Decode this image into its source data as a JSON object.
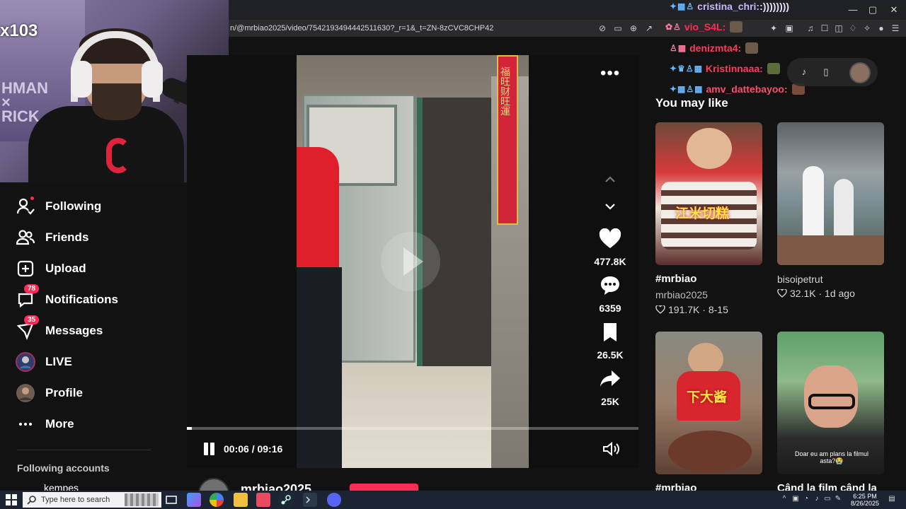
{
  "browser": {
    "url": "n/@mrbiao2025/video/7542193494442511630?_r=1&_t=ZN-8zCVC8CHP42"
  },
  "webcam": {
    "channel_id": "x103",
    "poster_text_1": "HMAN",
    "poster_text_2": "×",
    "poster_text_3": "RICK"
  },
  "sidebar": {
    "items": [
      {
        "label": "Following",
        "icon": "following-icon"
      },
      {
        "label": "Friends",
        "icon": "friends-icon"
      },
      {
        "label": "Upload",
        "icon": "upload-icon"
      },
      {
        "label": "Notifications",
        "icon": "notifications-icon",
        "badge": "78"
      },
      {
        "label": "Messages",
        "icon": "messages-icon",
        "badge": "35"
      },
      {
        "label": "LIVE",
        "icon": "live-icon"
      },
      {
        "label": "Profile",
        "icon": "profile-icon"
      },
      {
        "label": "More",
        "icon": "more-icon"
      }
    ],
    "following_header": "Following accounts",
    "following_first": "kempes"
  },
  "video": {
    "current_time": "00:06",
    "duration": "09:16",
    "time_display": "00:06 / 09:16",
    "progress": 0.011,
    "banner_text": "福旺财旺運",
    "likes": "477.8K",
    "comments": "6359",
    "saves": "26.5K",
    "shares": "25K",
    "author": "mrbiao2025"
  },
  "right_panel": {
    "title": "You may like",
    "cards": [
      {
        "title": "#mrbiao",
        "author": "mrbiao2025",
        "likes": "191.7K",
        "date": "8-15",
        "overlay": "江米切糕"
      },
      {
        "title": "",
        "author": "bisoipetrut",
        "likes": "32.1K",
        "date": "1d ago"
      },
      {
        "title": "#mrbiao",
        "overlay": "下大酱"
      },
      {
        "title": "Când la film când la",
        "overlay": "Doar eu am plans la filmul asta?😭"
      }
    ]
  },
  "chat": [
    {
      "user": "cristina_chri",
      "message": ":))))))))",
      "color": "#c9b8ff"
    },
    {
      "user": "vio_S4L",
      "message": "",
      "color": "#fe2c55"
    },
    {
      "user": "denizmta4",
      "message": "",
      "color": "#ff3b5c"
    },
    {
      "user": "Kristinnaaa",
      "message": "",
      "color": "#ff3b5c"
    },
    {
      "user": "amv_dattebayoo",
      "message": "",
      "color": "#ff4d6d"
    }
  ],
  "taskbar": {
    "search_placeholder": "Type here to search",
    "time": "6:25 PM",
    "date": "8/26/2025"
  },
  "colors": {
    "accent": "#fe2c55",
    "background": "#121212"
  }
}
